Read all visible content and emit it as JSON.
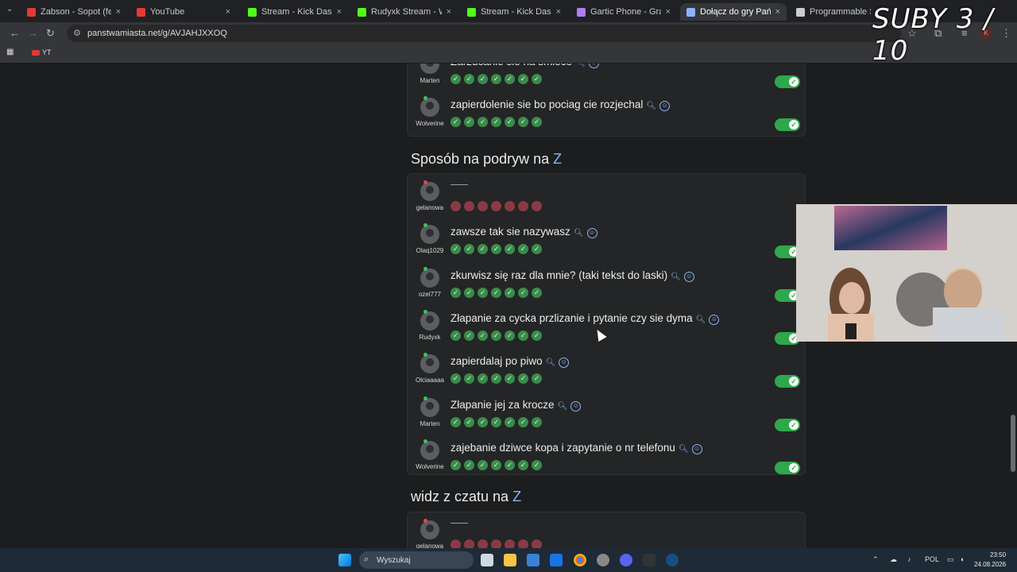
{
  "browser": {
    "tabs": [
      {
        "title": "Zabson - Sopot (feat.",
        "color": "#e53935"
      },
      {
        "title": "YouTube",
        "color": "#e53935"
      },
      {
        "title": "Stream - Kick Dashboard",
        "color": "#53fc18"
      },
      {
        "title": "Rudyxk Stream - Watch L",
        "color": "#53fc18"
      },
      {
        "title": "Stream - Kick Dashboard",
        "color": "#53fc18"
      },
      {
        "title": "Gartic Phone - Gra w głuc",
        "color": "#b07cf0"
      },
      {
        "title": "Dołącz do gry Państwa M",
        "color": "#8ab4f8"
      },
      {
        "title": "Programmable Search E",
        "color": "#cccccc"
      }
    ],
    "url": "panstwamiasta.net/g/AVJAHJXXOQ",
    "bookmark": "YT",
    "avatar_letter": "K"
  },
  "overlay": {
    "text": "SUBY 3 / 10"
  },
  "top_card": {
    "rows": [
      {
        "user": "Marten",
        "answer": "Zarzucanie sie na smiece",
        "votes": 7,
        "status": "online"
      },
      {
        "user": "Wolverine",
        "answer": "zapierdolenie sie bo pociag cie rozjechal",
        "votes": 7,
        "status": "online"
      }
    ]
  },
  "section1": {
    "title_prefix": "Sposób na podryw na",
    "letter": "Z",
    "rows": [
      {
        "user": "gelanowa",
        "answer": "",
        "votes": 7,
        "rejected": true,
        "status": "offline"
      },
      {
        "user": "Olaq1029",
        "answer": "zawsze tak sie nazywasz",
        "votes": 7,
        "status": "online"
      },
      {
        "user": "ozel777",
        "answer": "zkurwisz się raz dla mnie? (taki tekst do laski)",
        "votes": 7,
        "status": "online"
      },
      {
        "user": "Rudyxk",
        "answer": "Złapanie za cycka przlizanie i pytanie czy sie dyma",
        "votes": 7,
        "status": "online"
      },
      {
        "user": "Olciaaaaa",
        "answer": "zapierdalaj po piwo",
        "votes": 7,
        "status": "online"
      },
      {
        "user": "Marten",
        "answer": "Złapanie jej za krocze",
        "votes": 7,
        "status": "online"
      },
      {
        "user": "Wolverine",
        "answer": "zajebanie dziwce kopa i zapytanie o nr telefonu",
        "votes": 7,
        "status": "online"
      }
    ]
  },
  "section2": {
    "title_prefix": "widz z czatu na",
    "letter": "Z",
    "rows": [
      {
        "user": "gelanowa",
        "answer": "",
        "votes": 7,
        "rejected": true,
        "status": "offline"
      }
    ]
  },
  "taskbar": {
    "search_placeholder": "Wyszukaj",
    "language": "POL",
    "time": "23:50",
    "date": "24.08.2026"
  }
}
